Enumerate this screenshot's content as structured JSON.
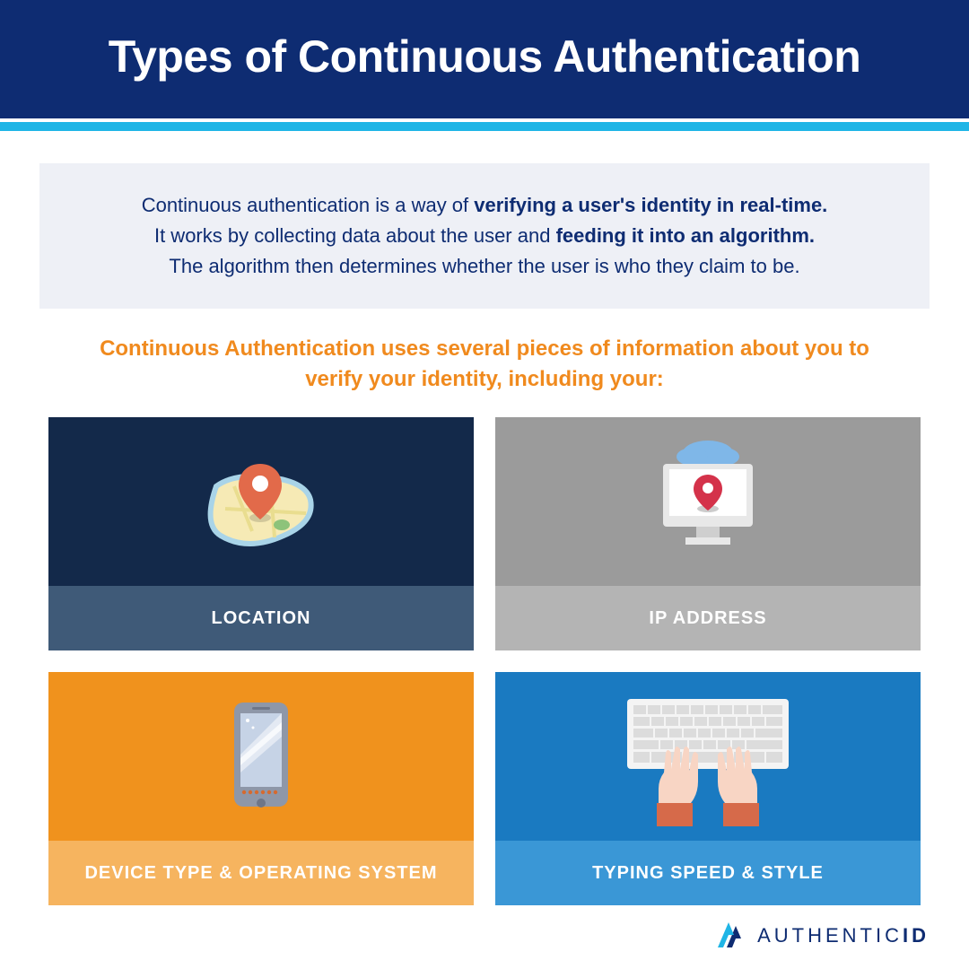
{
  "header": {
    "title": "Types of Continuous Authentication"
  },
  "intro": {
    "line1_a": "Continuous authentication is a way of ",
    "line1_b": "verifying a user's identity in real-time.",
    "line2_a": "It works by collecting data about the user and ",
    "line2_b": "feeding it into an algorithm.",
    "line3": "The algorithm then determines whether the user is who they claim to be."
  },
  "subhead": "Continuous Authentication uses several pieces of information about you to verify your identity, including your:",
  "cards": {
    "location": "LOCATION",
    "ip": "IP ADDRESS",
    "device": "DEVICE TYPE & OPERATING SYSTEM",
    "typing": "TYPING SPEED & STYLE"
  },
  "brand": {
    "name_a": "AUTHENTIC",
    "name_b": "ID"
  },
  "colors": {
    "navy": "#0e2c72",
    "cyan": "#1fb5e6",
    "orange": "#f08a1e",
    "card1_bg": "#13294a",
    "card2_bg": "#9b9b9b",
    "card3_bg": "#f0921d",
    "card4_bg": "#1a7ac1"
  }
}
